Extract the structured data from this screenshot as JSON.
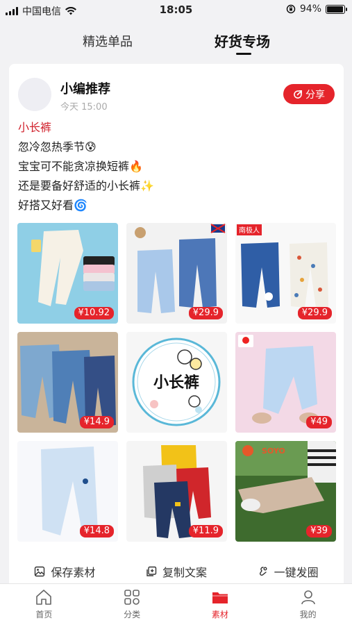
{
  "statusbar": {
    "carrier": "中国电信",
    "time": "18:05",
    "battery": "94%",
    "battery_level": 0.94
  },
  "tabs": [
    {
      "label": "精选单品"
    },
    {
      "label": "好货专场"
    }
  ],
  "post": {
    "author": "小编推荐",
    "time": "今天 15:00",
    "share_label": "分享",
    "topic": "小长裤",
    "lines": [
      "忽冷忽热季节😰",
      "宝宝可不能贪凉换短裤🔥",
      "还是要备好舒适的小长裤✨",
      "好搭又好看🌀"
    ],
    "products": [
      {
        "price": "¥10.92"
      },
      {
        "price": "¥29.9"
      },
      {
        "price": "¥29.9",
        "brand": "南极人"
      },
      {
        "price": "¥14.9"
      },
      {
        "center_text": "小长裤"
      },
      {
        "price": "¥49"
      },
      {
        "price": "¥14.8"
      },
      {
        "price": "¥11.9"
      },
      {
        "price": "¥39",
        "brand": "SOYO"
      }
    ],
    "actions": [
      {
        "label": "保存素材"
      },
      {
        "label": "复制文案"
      },
      {
        "label": "一键发圈"
      }
    ]
  },
  "bottomnav": [
    {
      "label": "首页"
    },
    {
      "label": "分类"
    },
    {
      "label": "素材"
    },
    {
      "label": "我的"
    }
  ],
  "colors": {
    "accent": "#e5242b",
    "topic": "#d0202b"
  }
}
